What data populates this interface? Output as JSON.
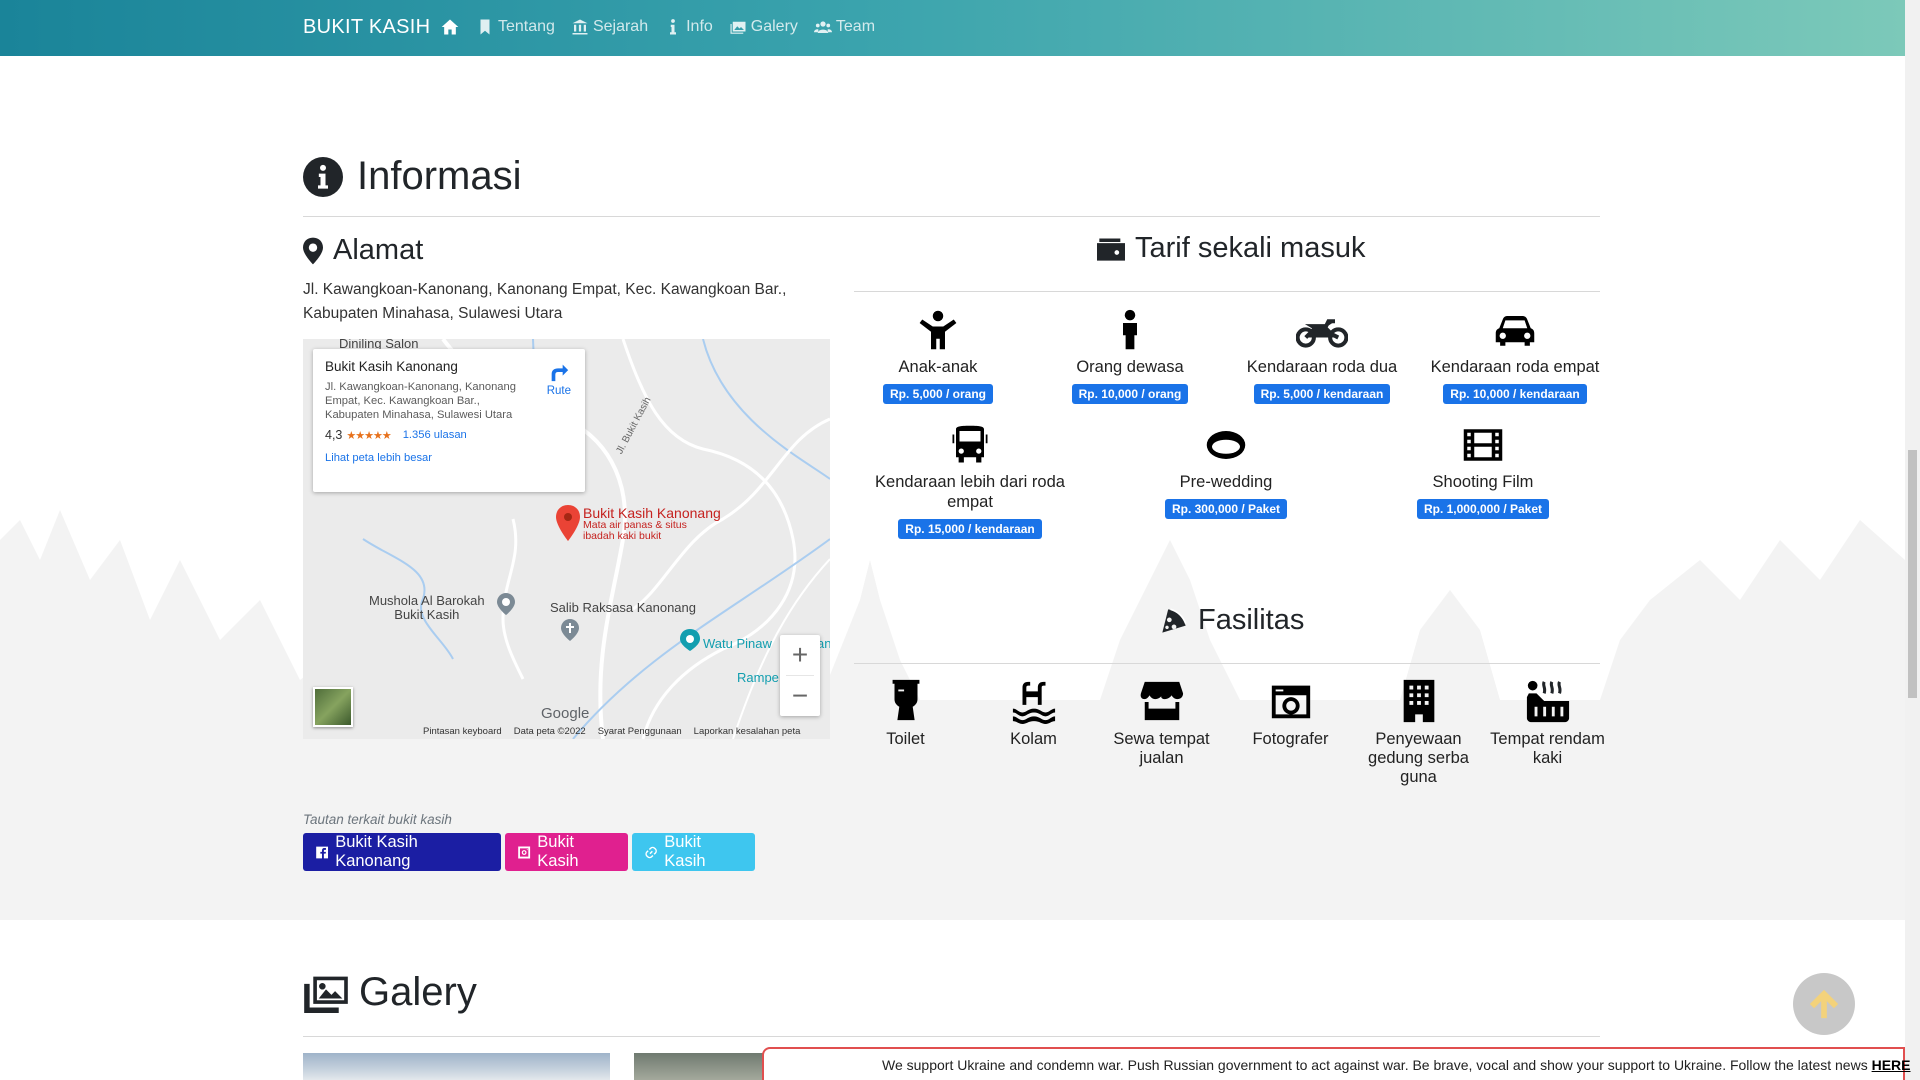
{
  "navbar": {
    "brand": "BUKIT KASIH",
    "items": [
      {
        "label": "",
        "icon": "home-icon"
      },
      {
        "label": "Tentang",
        "icon": "bookmark-icon"
      },
      {
        "label": "Sejarah",
        "icon": "landmark-icon"
      },
      {
        "label": "Info",
        "icon": "info-icon"
      },
      {
        "label": "Galery",
        "icon": "images-icon"
      },
      {
        "label": "Team",
        "icon": "users-icon"
      }
    ]
  },
  "informasi": {
    "title": "Informasi",
    "alamat": {
      "title": "Alamat",
      "text": "Jl. Kawangkoan-Kanonang, Kanonang Empat, Kec. Kawangkoan Bar., Kabupaten Minahasa, Sulawesi Utara"
    },
    "map": {
      "place_name": "Bukit Kasih Kanonang",
      "place_address": "Jl. Kawangkoan-Kanonang, Kanonang Empat, Kec. Kawangkoan Bar., Kabupaten Minahasa, Sulawesi Utara",
      "rating": "4,3",
      "stars": "★★★★★",
      "reviews": "1.356 ulasan",
      "view_larger": "Lihat peta lebih besar",
      "route": "Rute",
      "labels": {
        "top_partial": "Diniling Salon",
        "road": "Jl. Bukit Kasih",
        "marker_title": "Bukit Kasih Kanonang",
        "marker_sub1": "Mata air panas & situs",
        "marker_sub2": "ibadah kaki bukit",
        "mushola1": "Mushola Al Barokah",
        "mushola2": "Bukit Kasih",
        "salib": "Salib Raksasa Kanonang",
        "watu": "Watu Pinaw",
        "watu_tail": "an",
        "rampe": "Rampe"
      },
      "zoom_in": "+",
      "zoom_out": "−",
      "google": "Google",
      "footer": [
        "Pintasan keyboard",
        "Data peta ©2022",
        "Syarat Penggunaan",
        "Laporkan kesalahan peta"
      ]
    },
    "links": {
      "caption": "Tautan terkait bukit kasih",
      "buttons": [
        {
          "label": "Bukit Kasih Kanonang",
          "icon": "facebook-icon",
          "color": "#1b1ea3"
        },
        {
          "label": "Bukit Kasih",
          "icon": "instagram-icon",
          "color": "#e0208f"
        },
        {
          "label": "Bukit Kasih",
          "icon": "link-icon",
          "color": "#3ec6ef"
        }
      ]
    },
    "tarif": {
      "title": "Tarif sekali masuk",
      "items": [
        {
          "label": "Anak-anak",
          "price": "Rp. 5,000 / orang",
          "icon": "child-icon"
        },
        {
          "label": "Orang dewasa",
          "price": "Rp. 10,000 / orang",
          "icon": "male-icon"
        },
        {
          "label": "Kendaraan roda dua",
          "price": "Rp. 5,000 / kendaraan",
          "icon": "motorcycle-icon"
        },
        {
          "label": "Kendaraan roda empat",
          "price": "Rp. 10,000 / kendaraan",
          "icon": "car-icon"
        },
        {
          "label": "Kendaraan lebih dari roda empat",
          "price": "Rp. 15,000 / kendaraan",
          "icon": "bus-icon"
        },
        {
          "label": "Pre-wedding",
          "price": "Rp. 300,000 / Paket",
          "icon": "ring-icon"
        },
        {
          "label": "Shooting Film",
          "price": "Rp. 1,000,000 / Paket",
          "icon": "film-icon"
        }
      ]
    },
    "fasilitas": {
      "title": "Fasilitas",
      "items": [
        {
          "label": "Toilet",
          "icon": "toilet-icon"
        },
        {
          "label": "Kolam",
          "icon": "swimming-pool-icon"
        },
        {
          "label": "Sewa tempat jualan",
          "icon": "store-icon"
        },
        {
          "label": "Fotografer",
          "icon": "camera-icon"
        },
        {
          "label": "Penyewaan gedung serba guna",
          "icon": "building-icon"
        },
        {
          "label": "Tempat rendam kaki",
          "icon": "hot-tub-icon"
        }
      ]
    }
  },
  "galery": {
    "title": "Galery"
  },
  "banner": {
    "text": "We support Ukraine and condemn war. Push Russian government to act against war. Be brave, vocal and show your support to Ukraine. Follow the latest news ",
    "link": "HERE"
  },
  "colors": {
    "primary_badge": "#1a73e8",
    "navbar_start": "#1a8499",
    "navbar_end": "#7cc9b9"
  }
}
